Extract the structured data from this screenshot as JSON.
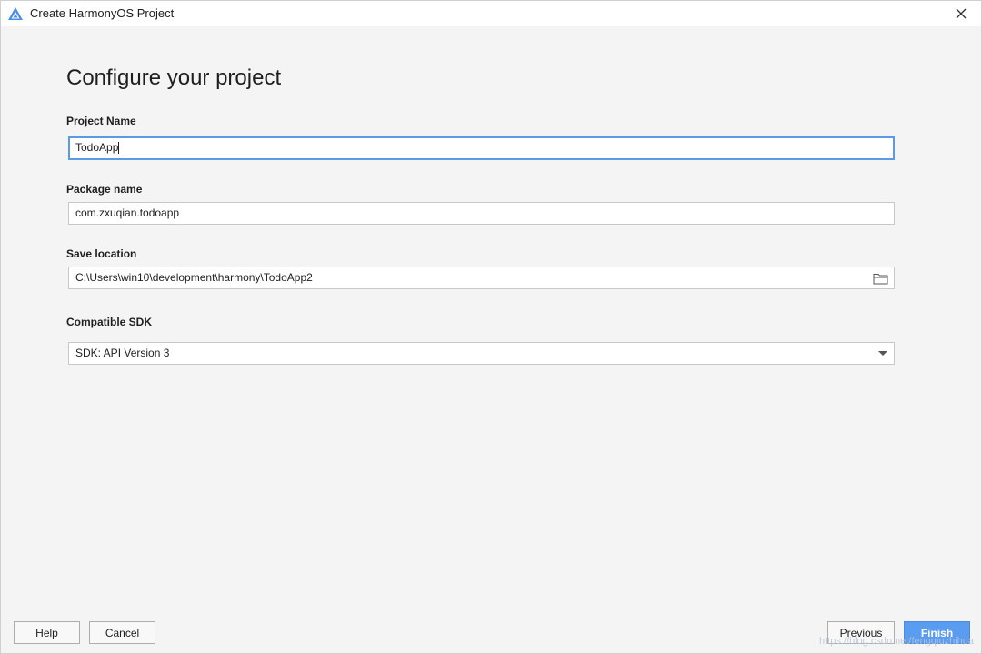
{
  "window": {
    "title": "Create HarmonyOS Project"
  },
  "page": {
    "title": "Configure your project"
  },
  "fields": {
    "project_name": {
      "label": "Project Name",
      "value": "TodoApp"
    },
    "package_name": {
      "label": "Package name",
      "value": "com.zxuqian.todoapp"
    },
    "save_location": {
      "label": "Save location",
      "value": "C:\\Users\\win10\\development\\harmony\\TodoApp2"
    },
    "compatible_sdk": {
      "label": "Compatible SDK",
      "selected": "SDK: API Version 3"
    }
  },
  "footer": {
    "help_label": "Help",
    "cancel_label": "Cancel",
    "previous_label": "Previous",
    "finish_label": "Finish"
  },
  "watermark": "https://blog.csdn.net/fengqiuzhihua",
  "colors": {
    "accent": "#5a9df0",
    "focus_border": "#5c9ae6",
    "background": "#f4f4f4"
  },
  "icons": {
    "app_logo": "harmony-logo-icon",
    "close": "close-icon",
    "folder": "folder-icon",
    "dropdown": "chevron-down-icon"
  }
}
